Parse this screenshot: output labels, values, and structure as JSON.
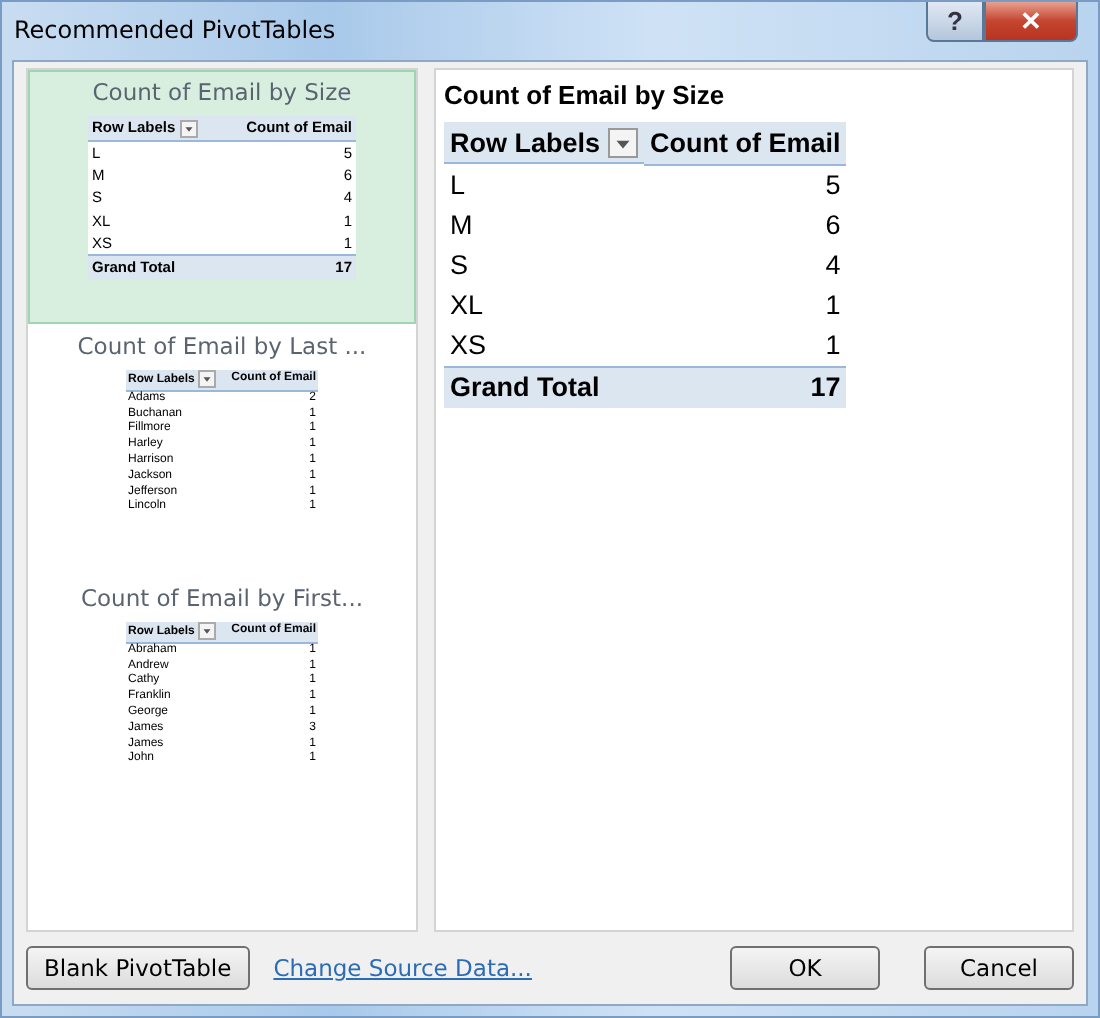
{
  "window": {
    "title": "Recommended PivotTables",
    "help_button": "?",
    "close_button": "✕"
  },
  "recommendations": [
    {
      "title": "Count of Email by Size",
      "selected": true,
      "headers": [
        "Row Labels",
        "Count of Email"
      ],
      "rows": [
        [
          "L",
          "5"
        ],
        [
          "M",
          "6"
        ],
        [
          "S",
          "4"
        ],
        [
          "XL",
          "1"
        ],
        [
          "XS",
          "1"
        ]
      ],
      "total": [
        "Grand Total",
        "17"
      ]
    },
    {
      "title": "Count of Email by Last ...",
      "selected": false,
      "headers": [
        "Row Labels",
        "Count of Email"
      ],
      "rows": [
        [
          "Adams",
          "2"
        ],
        [
          "Buchanan",
          "1"
        ],
        [
          "Fillmore",
          "1"
        ],
        [
          "Harley",
          "1"
        ],
        [
          "Harrison",
          "1"
        ],
        [
          "Jackson",
          "1"
        ],
        [
          "Jefferson",
          "1"
        ],
        [
          "Lincoln",
          "1"
        ]
      ]
    },
    {
      "title": "Count of Email by First...",
      "selected": false,
      "headers": [
        "Row Labels",
        "Count of Email"
      ],
      "rows": [
        [
          "Abraham",
          "1"
        ],
        [
          "Andrew",
          "1"
        ],
        [
          "Cathy",
          "1"
        ],
        [
          "Franklin",
          "1"
        ],
        [
          "George",
          "1"
        ],
        [
          "James",
          "3"
        ],
        [
          "James",
          "1"
        ],
        [
          "John",
          "1"
        ]
      ]
    }
  ],
  "preview": {
    "title": "Count of Email by Size",
    "headers": [
      "Row Labels",
      "Count of Email"
    ],
    "rows": [
      [
        "L",
        "5"
      ],
      [
        "M",
        "6"
      ],
      [
        "S",
        "4"
      ],
      [
        "XL",
        "1"
      ],
      [
        "XS",
        "1"
      ]
    ],
    "total": [
      "Grand Total",
      "17"
    ]
  },
  "buttons": {
    "blank": "Blank PivotTable",
    "link": "Change Source Data...",
    "ok": "OK",
    "cancel": "Cancel"
  }
}
